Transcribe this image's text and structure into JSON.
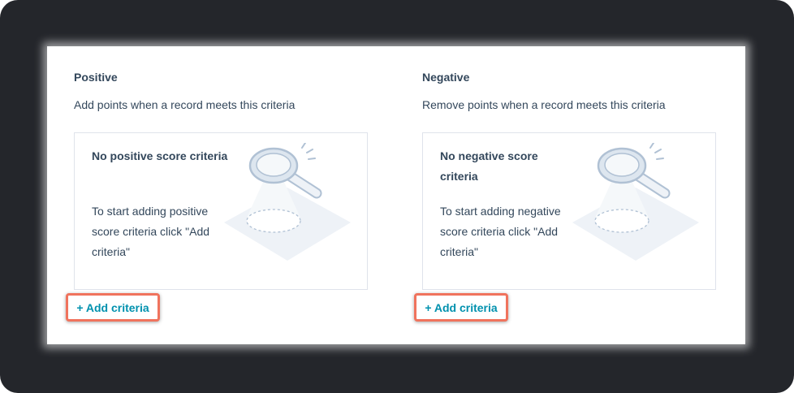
{
  "positive": {
    "heading": "Positive",
    "description": "Add points when a record meets this criteria",
    "empty_title": "No positive score criteria",
    "empty_body": "To start adding positive score criteria click \"Add criteria\"",
    "add_button": "+ Add criteria",
    "illustration_icon": "magnifying-glass-icon"
  },
  "negative": {
    "heading": "Negative",
    "description": "Remove points when a record meets this criteria",
    "empty_title": "No negative score criteria",
    "empty_body": "To start adding negative score criteria click \"Add criteria\"",
    "add_button": "+ Add criteria",
    "illustration_icon": "magnifying-glass-icon"
  },
  "colors": {
    "text": "#33475b",
    "link": "#0091ae",
    "highlight": "#f0735d",
    "frame": "#24262b",
    "card_border": "#dfe3eb"
  }
}
